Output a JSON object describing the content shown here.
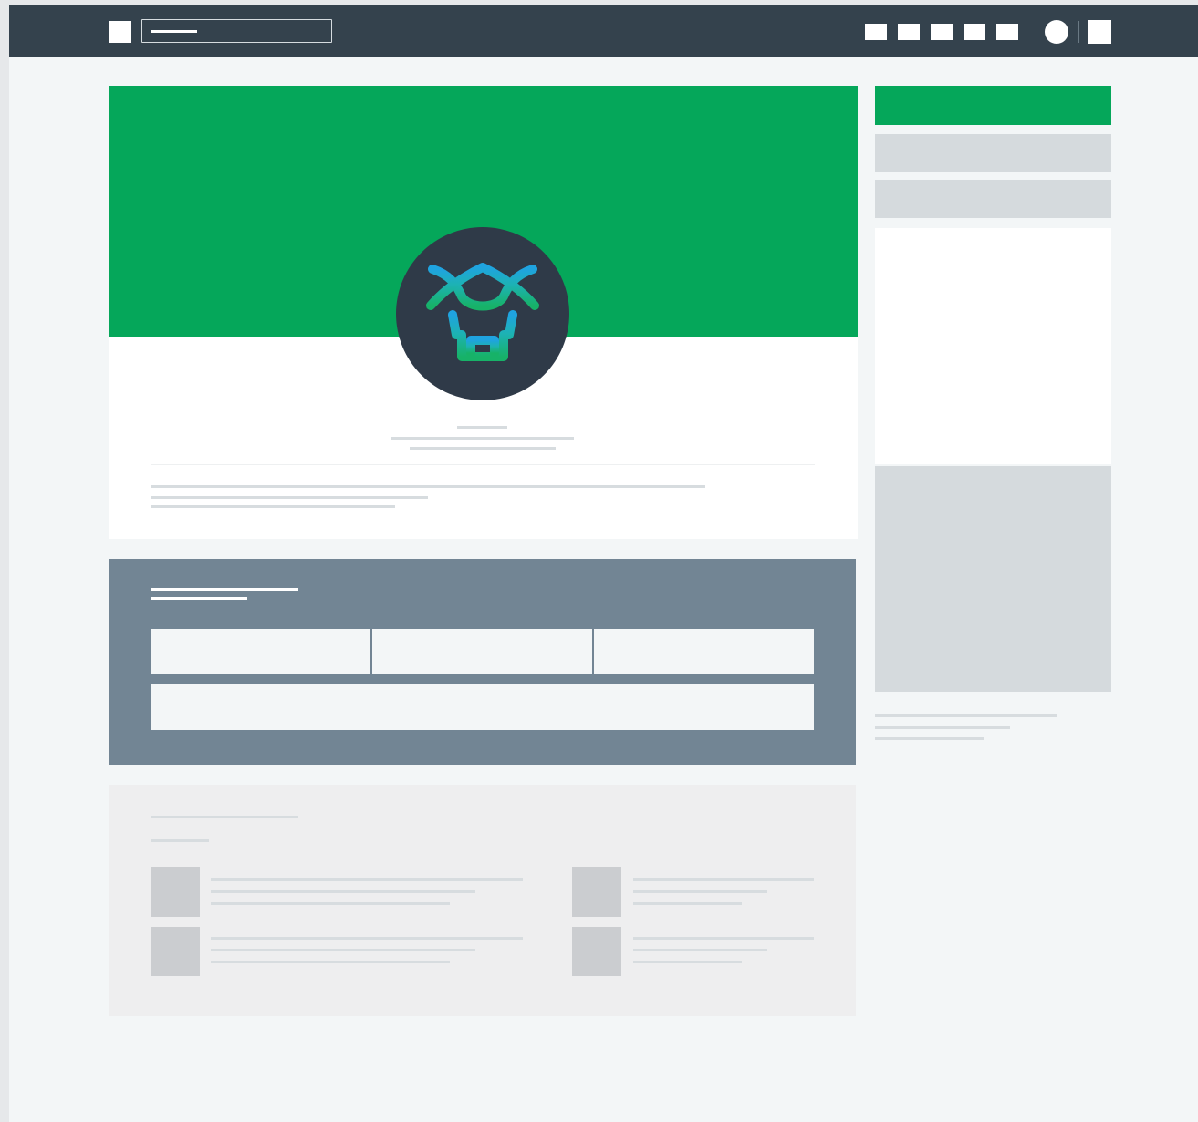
{
  "topbar": {
    "background": "#34424d",
    "icons": [
      "app-logo-icon",
      "search-icon",
      "nav-icon-1",
      "nav-icon-2",
      "nav-icon-3",
      "nav-icon-4",
      "nav-icon-5",
      "profile-avatar-icon",
      "apps-grid-icon"
    ]
  },
  "colors": {
    "brand_green": "#05a75a",
    "navy": "#2f3a48",
    "slate": "#728594",
    "placeholder_gray": "#d5dadd"
  },
  "profile": {
    "logo_icon": "bull-head-icon"
  }
}
